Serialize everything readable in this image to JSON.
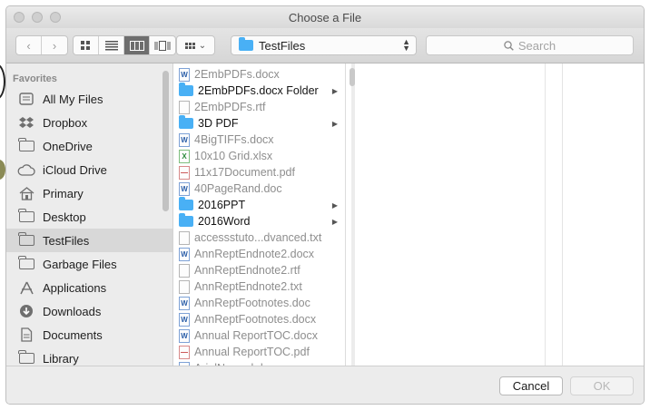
{
  "window": {
    "title": "Choose a File"
  },
  "toolbar": {
    "back_icon": "chevron-left-icon",
    "forward_icon": "chevron-right-icon",
    "views": [
      "icon-view-icon",
      "list-view-icon",
      "column-view-icon",
      "coverflow-view-icon"
    ],
    "active_view": "column-view-icon",
    "path": "TestFiles",
    "search_placeholder": "Search"
  },
  "sidebar": {
    "header": "Favorites",
    "items": [
      {
        "label": "All My Files",
        "icon": "all-files-icon"
      },
      {
        "label": "Dropbox",
        "icon": "dropbox-icon"
      },
      {
        "label": "OneDrive",
        "icon": "cloud-icon"
      },
      {
        "label": "iCloud Drive",
        "icon": "icloud-icon"
      },
      {
        "label": "Primary",
        "icon": "home-icon"
      },
      {
        "label": "Desktop",
        "icon": "desktop-icon"
      },
      {
        "label": "TestFiles",
        "icon": "folder-icon",
        "selected": true
      },
      {
        "label": "Garbage Files",
        "icon": "folder-icon"
      },
      {
        "label": "Applications",
        "icon": "applications-icon"
      },
      {
        "label": "Downloads",
        "icon": "downloads-icon"
      },
      {
        "label": "Documents",
        "icon": "documents-icon"
      },
      {
        "label": "Library",
        "icon": "folder-icon"
      }
    ]
  },
  "files": [
    {
      "name": "2EmbPDFs.docx",
      "kind": "word"
    },
    {
      "name": "2EmbPDFs.docx Folder",
      "kind": "folder"
    },
    {
      "name": "2EmbPDFs.rtf",
      "kind": "doc"
    },
    {
      "name": "3D PDF",
      "kind": "folder"
    },
    {
      "name": "4BigTIFFs.docx",
      "kind": "word"
    },
    {
      "name": "10x10 Grid.xlsx",
      "kind": "excel"
    },
    {
      "name": "11x17Document.pdf",
      "kind": "pdf"
    },
    {
      "name": "40PageRand.doc",
      "kind": "word"
    },
    {
      "name": "2016PPT",
      "kind": "folder"
    },
    {
      "name": "2016Word",
      "kind": "folder"
    },
    {
      "name": "accessstuto...dvanced.txt",
      "kind": "doc"
    },
    {
      "name": "AnnReptEndnote2.docx",
      "kind": "word"
    },
    {
      "name": "AnnReptEndnote2.rtf",
      "kind": "doc"
    },
    {
      "name": "AnnReptEndnote2.txt",
      "kind": "doc"
    },
    {
      "name": "AnnReptFootnotes.doc",
      "kind": "word"
    },
    {
      "name": "AnnReptFootnotes.docx",
      "kind": "word"
    },
    {
      "name": "Annual ReportTOC.docx",
      "kind": "word"
    },
    {
      "name": "Annual ReportTOC.pdf",
      "kind": "pdf"
    },
    {
      "name": "ArialNormal.doc",
      "kind": "word"
    }
  ],
  "buttons": {
    "cancel": "Cancel",
    "ok": "OK"
  }
}
